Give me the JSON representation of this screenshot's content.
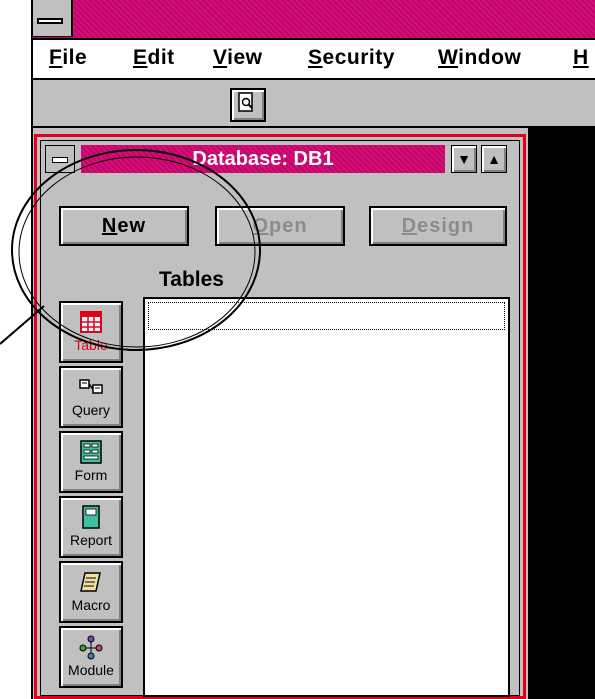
{
  "menubar": {
    "items": [
      {
        "label": "File",
        "underline": "F",
        "rest": "ile"
      },
      {
        "label": "Edit",
        "underline": "E",
        "rest": "dit"
      },
      {
        "label": "View",
        "underline": "V",
        "rest": "iew"
      },
      {
        "label": "Security",
        "underline": "S",
        "rest": "ecurity"
      },
      {
        "label": "Window",
        "underline": "W",
        "rest": "indow"
      },
      {
        "label": "Help",
        "underline": "H",
        "rest": ""
      }
    ]
  },
  "database_window": {
    "title": "Database: DB1",
    "buttons": {
      "new": {
        "first": "N",
        "rest": "ew"
      },
      "open": {
        "first": "O",
        "rest": "pen"
      },
      "design": {
        "first": "D",
        "rest": "esign"
      }
    },
    "section_label": "Tables",
    "tabs": [
      "Table",
      "Query",
      "Form",
      "Report",
      "Macro",
      "Module"
    ]
  },
  "colors": {
    "title_bar": "#c8006a",
    "window_border": "#e0001a",
    "face": "#c0c0c0"
  }
}
